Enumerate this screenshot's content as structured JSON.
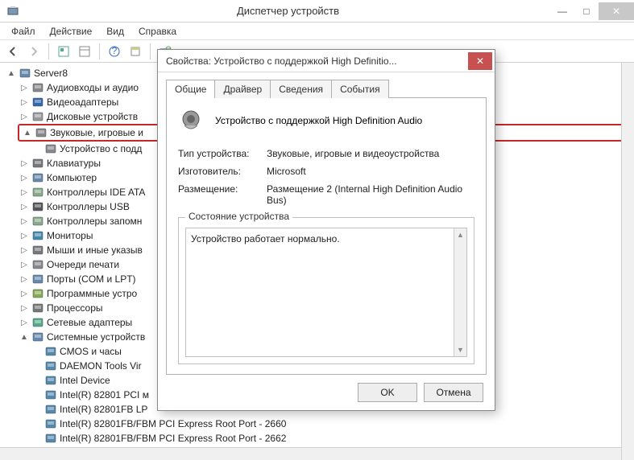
{
  "window": {
    "title": "Диспетчер устройств",
    "min": "—",
    "max": "□",
    "close": "✕"
  },
  "menu": {
    "file": "Файл",
    "action": "Действие",
    "view": "Вид",
    "help": "Справка"
  },
  "tree": {
    "root": "Server8",
    "categories": [
      {
        "label": "Аудиовходы и аудио",
        "expander": "▷",
        "icon": "audio-icon"
      },
      {
        "label": "Видеоадаптеры",
        "expander": "▷",
        "icon": "display-icon"
      },
      {
        "label": "Дисковые устройств",
        "expander": "▷",
        "icon": "disk-icon"
      },
      {
        "label": "Звуковые, игровые и",
        "expander": "▲",
        "icon": "sound-icon",
        "highlighted": true,
        "children": [
          {
            "label": "Устройство с подд",
            "icon": "sound-icon"
          }
        ]
      },
      {
        "label": "Клавиатуры",
        "expander": "▷",
        "icon": "keyboard-icon"
      },
      {
        "label": "Компьютер",
        "expander": "▷",
        "icon": "computer-icon"
      },
      {
        "label": "Контроллеры IDE ATA",
        "expander": "▷",
        "icon": "controller-icon"
      },
      {
        "label": "Контроллеры USB",
        "expander": "▷",
        "icon": "usb-icon"
      },
      {
        "label": "Контроллеры запомн",
        "expander": "▷",
        "icon": "storage-icon"
      },
      {
        "label": "Мониторы",
        "expander": "▷",
        "icon": "monitor-icon"
      },
      {
        "label": "Мыши и иные указыв",
        "expander": "▷",
        "icon": "mouse-icon"
      },
      {
        "label": "Очереди печати",
        "expander": "▷",
        "icon": "print-icon"
      },
      {
        "label": "Порты (COM и LPT)",
        "expander": "▷",
        "icon": "port-icon"
      },
      {
        "label": "Программные устро",
        "expander": "▷",
        "icon": "software-icon"
      },
      {
        "label": "Процессоры",
        "expander": "▷",
        "icon": "cpu-icon"
      },
      {
        "label": "Сетевые адаптеры",
        "expander": "▷",
        "icon": "network-icon"
      },
      {
        "label": "Системные устройств",
        "expander": "▲",
        "icon": "system-icon",
        "children": [
          {
            "label": "CMOS и часы",
            "icon": "chip-icon"
          },
          {
            "label": "DAEMON Tools Vir",
            "icon": "chip-icon"
          },
          {
            "label": "Intel Device",
            "icon": "chip-icon"
          },
          {
            "label": "Intel(R) 82801 PCI м",
            "icon": "chip-icon"
          },
          {
            "label": "Intel(R) 82801FB LP",
            "icon": "chip-icon"
          },
          {
            "label": "Intel(R) 82801FB/FBM PCI Express Root Port - 2660",
            "icon": "chip-icon"
          },
          {
            "label": "Intel(R) 82801FB/FBM PCI Express Root Port - 2662",
            "icon": "chip-icon"
          }
        ]
      }
    ]
  },
  "dialog": {
    "title": "Свойства: Устройство с поддержкой High Definitio...",
    "close": "✕",
    "tabs": {
      "general": "Общие",
      "driver": "Драйвер",
      "details": "Сведения",
      "events": "События"
    },
    "device_name": "Устройство с поддержкой High Definition Audio",
    "labels": {
      "type": "Тип устройства:",
      "manufacturer": "Изготовитель:",
      "location": "Размещение:"
    },
    "values": {
      "type": "Звуковые, игровые и видеоустройства",
      "manufacturer": "Microsoft",
      "location": "Размещение 2 (Internal High Definition Audio Bus)"
    },
    "status_label": "Состояние устройства",
    "status_text": "Устройство работает нормально.",
    "ok": "OK",
    "cancel": "Отмена"
  }
}
